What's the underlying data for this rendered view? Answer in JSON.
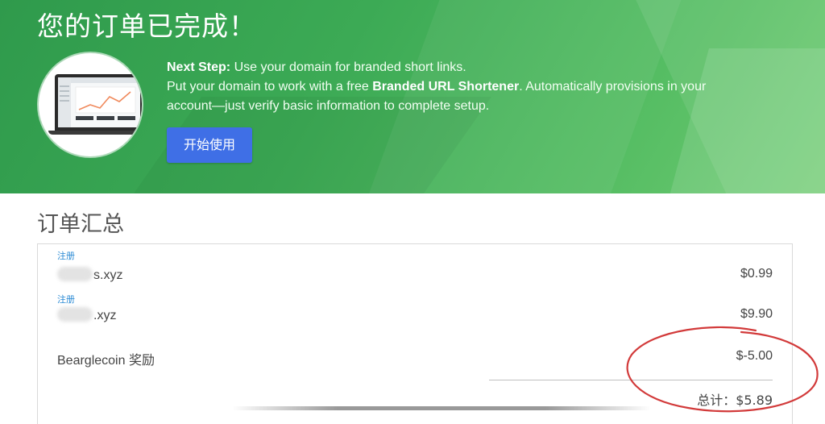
{
  "hero": {
    "title": "您的订单已完成！",
    "next_step_label": "Next Step:",
    "next_step_text": " Use your domain for branded short links.",
    "line2_prefix": "Put your domain to work with a free ",
    "line2_bold": "Branded URL Shortener",
    "line2_suffix": ". Automatically provisions in your",
    "line3": "account—just verify basic information to complete setup.",
    "cta_label": "开始使用"
  },
  "summary": {
    "title": "订单汇总",
    "items": [
      {
        "tag": "注册",
        "name": "s.xyz",
        "price": "$0.99"
      },
      {
        "tag": "注册",
        "name": ".xyz",
        "price": "$9.90"
      },
      {
        "tag": "",
        "name": "Bearglecoin 奖励",
        "price": "$-5.00"
      }
    ],
    "total": "总计：$5.89"
  },
  "colors": {
    "hero_green": "#3caa55",
    "cta_blue": "#3f6fe6",
    "tag_blue": "#2a8ad4",
    "annotation_red": "#d23a3a"
  },
  "icons": {
    "thumbnail": "laptop-dashboard-illustration",
    "annotation": "red-hand-drawn-circle"
  }
}
